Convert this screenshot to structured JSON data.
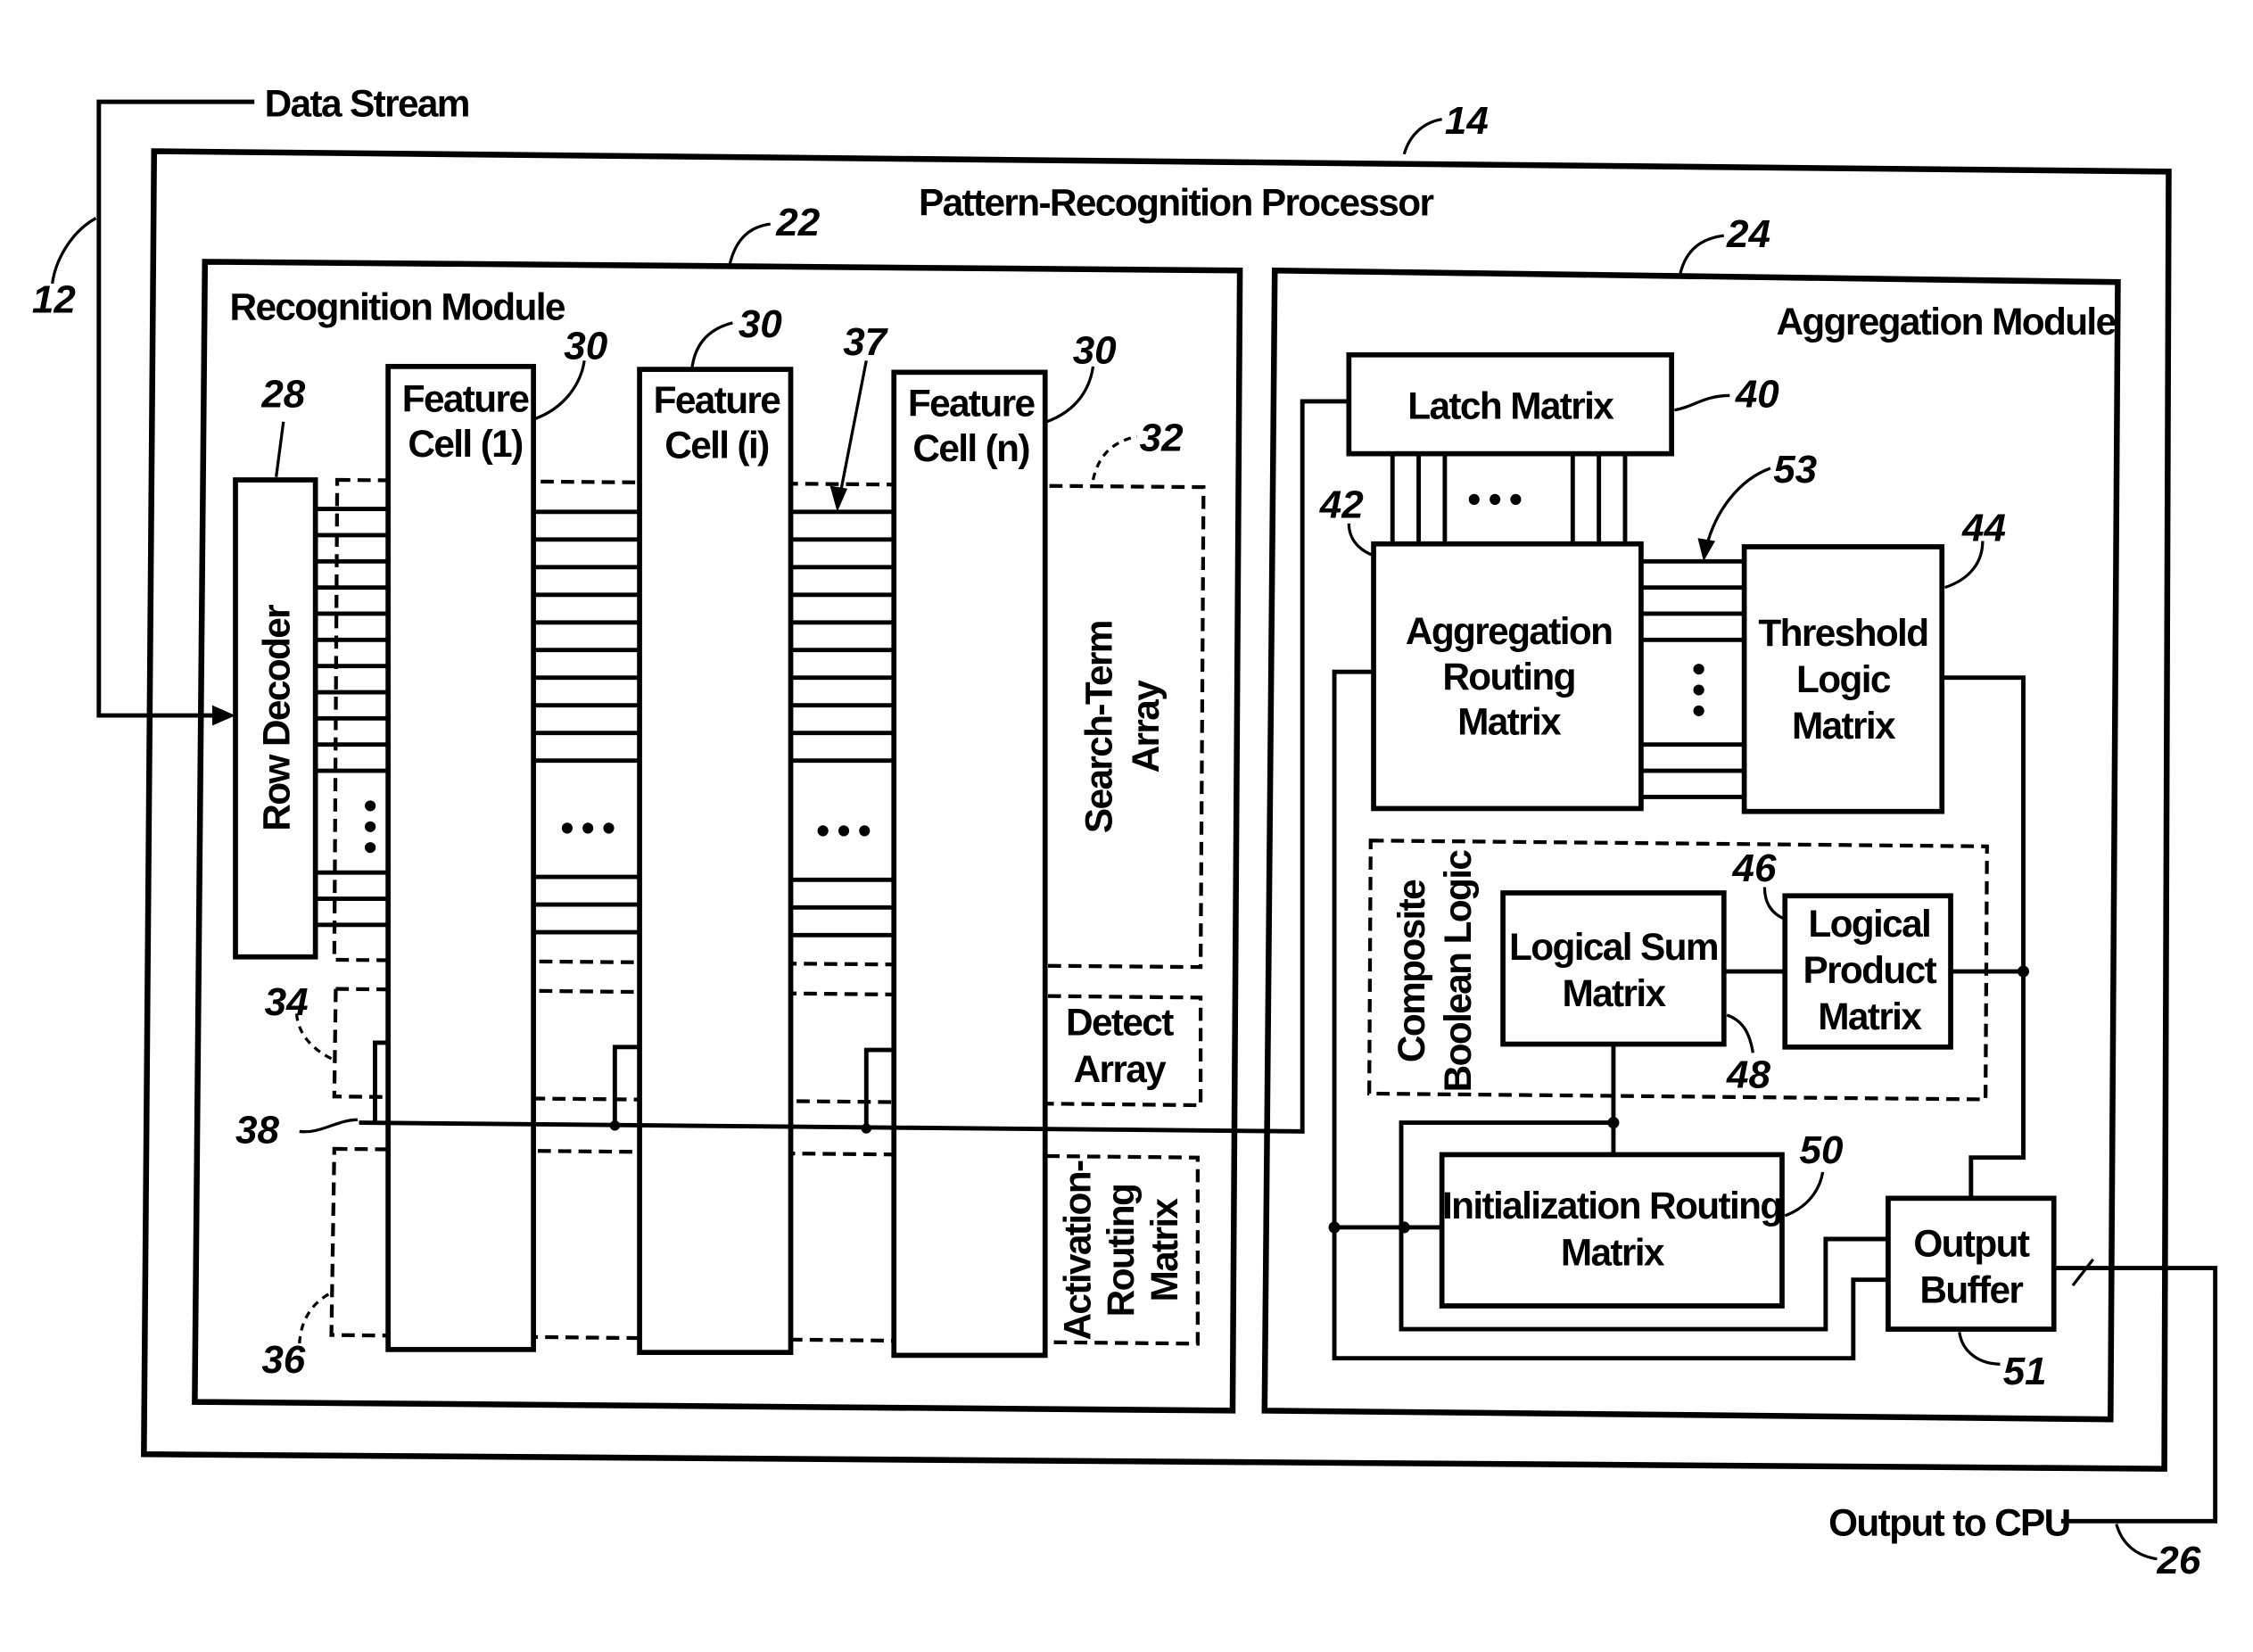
{
  "diagram": {
    "inputs": {
      "data_stream": "Data Stream",
      "output_to_cpu": "Output to CPU"
    },
    "processor": {
      "title": "Pattern-Recognition Processor",
      "ref": "14"
    },
    "recognition_module": {
      "title": "Recognition Module",
      "ref": "22",
      "row_decoder": {
        "label": "Row Decoder",
        "ref": "28"
      },
      "feature_cells": [
        {
          "line1": "Feature",
          "line2": "Cell (1)",
          "ref": "30"
        },
        {
          "line1": "Feature",
          "line2": "Cell (i)",
          "ref": "30"
        },
        {
          "line1": "Feature",
          "line2": "Cell (n)",
          "ref": "30"
        }
      ],
      "search_term_array": {
        "line1": "Search-Term",
        "line2": "Array",
        "ref": "32"
      },
      "detect_array": {
        "line1": "Detect",
        "line2": "Array",
        "ref": "34"
      },
      "activation_routing_matrix": {
        "line1": "Activation-",
        "line2": "Routing",
        "line3": "Matrix",
        "ref": "36"
      },
      "search_term_ref": "37",
      "detect_bus_ref": "38",
      "ellipsis": "• • •"
    },
    "aggregation_module": {
      "title": "Aggregation Module",
      "ref": "24",
      "latch_matrix": {
        "label": "Latch Matrix",
        "ref": "40"
      },
      "aggregation_routing_matrix": {
        "line1": "Aggregation",
        "line2": "Routing",
        "line3": "Matrix",
        "ref": "42"
      },
      "threshold_logic_matrix": {
        "line1": "Threshold",
        "line2": "Logic",
        "line3": "Matrix",
        "ref": "44"
      },
      "bus_ref": "53",
      "composite_boolean_logic": {
        "line1": "Composite",
        "line2": "Boolean Logic"
      },
      "logical_sum_matrix": {
        "line1": "Logical Sum",
        "line2": "Matrix",
        "ref": "48"
      },
      "logical_product_matrix": {
        "line1": "Logical",
        "line2": "Product",
        "line3": "Matrix",
        "ref": "46"
      },
      "initialization_routing_matrix": {
        "line1": "Initialization Routing",
        "line2": "Matrix",
        "ref": "50"
      },
      "output_buffer": {
        "line1": "Output",
        "line2": "Buffer",
        "ref": "51"
      }
    },
    "refs": {
      "data_stream_ref": "12",
      "output_ref": "26"
    }
  }
}
